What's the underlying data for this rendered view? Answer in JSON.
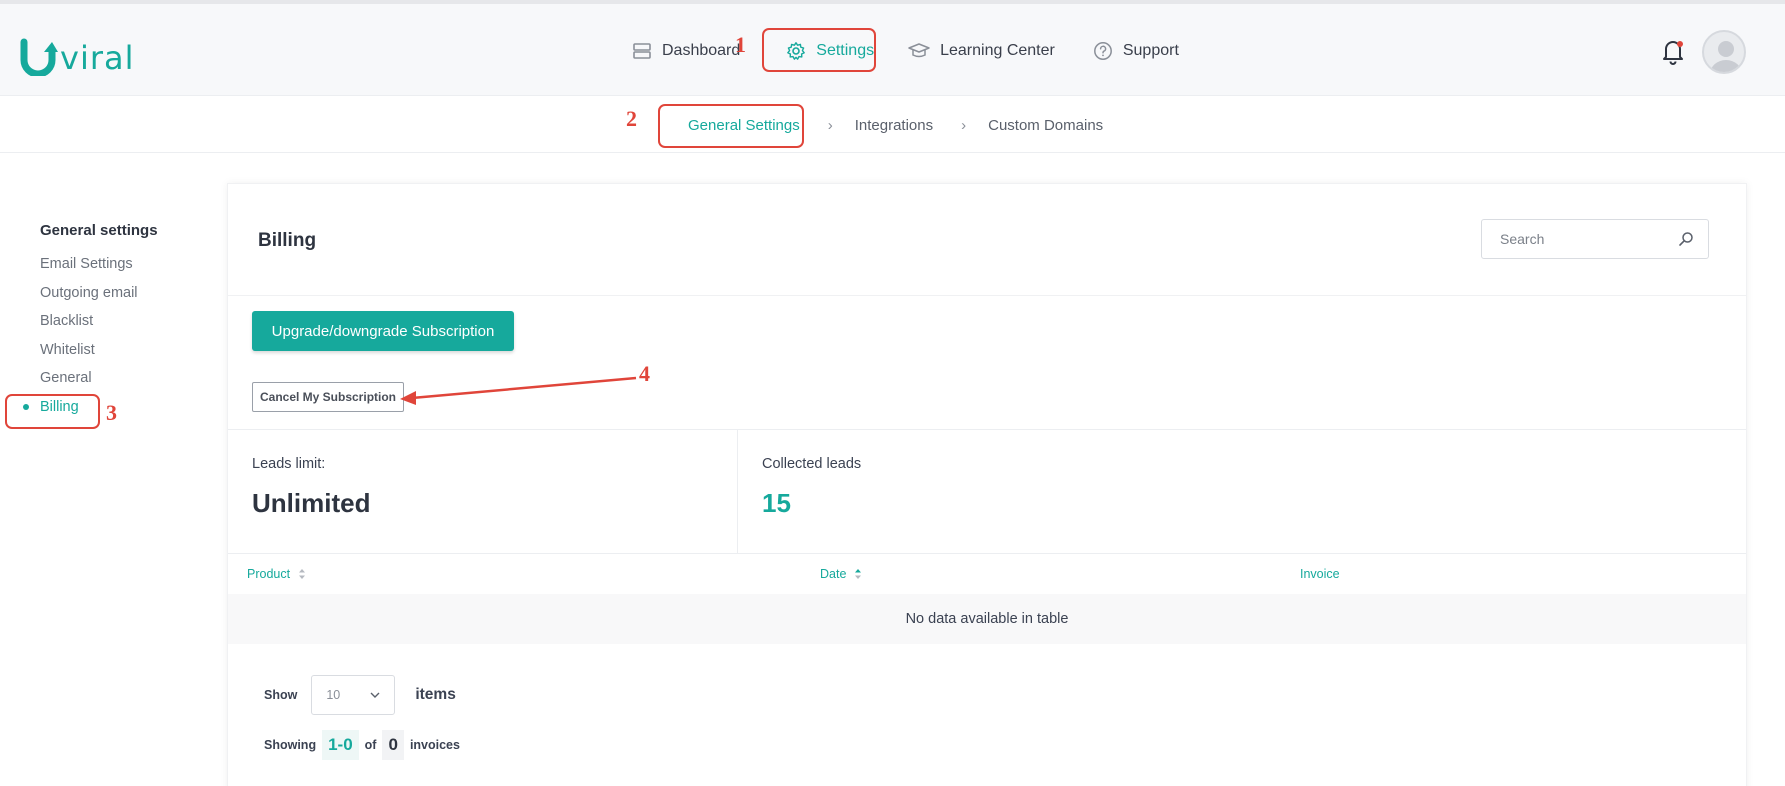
{
  "app": {
    "logo_text": "viral"
  },
  "topnav": [
    {
      "label": "Dashboard",
      "icon": "dashboard-icon",
      "active": false
    },
    {
      "label": "Settings",
      "icon": "gear-icon",
      "active": true
    },
    {
      "label": "Learning Center",
      "icon": "graduation-cap-icon",
      "active": false
    },
    {
      "label": "Support",
      "icon": "help-circle-icon",
      "active": false
    }
  ],
  "subnav": [
    {
      "label": "General Settings",
      "active": true
    },
    {
      "label": "Integrations",
      "active": false
    },
    {
      "label": "Custom Domains",
      "active": false
    }
  ],
  "sidebar": {
    "title": "General settings",
    "items": [
      {
        "label": "Email Settings",
        "active": false
      },
      {
        "label": "Outgoing email",
        "active": false
      },
      {
        "label": "Blacklist",
        "active": false
      },
      {
        "label": "Whitelist",
        "active": false
      },
      {
        "label": "General",
        "active": false
      },
      {
        "label": "Billing",
        "active": true
      }
    ]
  },
  "billing": {
    "title": "Billing",
    "search_placeholder": "Search",
    "upgrade_label": "Upgrade/downgrade Subscription",
    "cancel_label": "Cancel My Subscription",
    "leads_limit_label": "Leads limit:",
    "leads_limit_value": "Unlimited",
    "collected_label": "Collected leads",
    "collected_value": "15",
    "table": {
      "columns": [
        "Product",
        "Date",
        "Invoice"
      ],
      "empty_message": "No data available in table"
    },
    "pagination": {
      "show_label": "Show",
      "page_size": "10",
      "items_label": "items",
      "showing_label": "Showing",
      "range": "1-0",
      "of_label": "of",
      "total": "0",
      "invoices_label": "invoices"
    }
  },
  "annotations": [
    "1",
    "2",
    "3",
    "4"
  ],
  "colors": {
    "accent": "#16a99c",
    "annotation": "#e0453a"
  }
}
